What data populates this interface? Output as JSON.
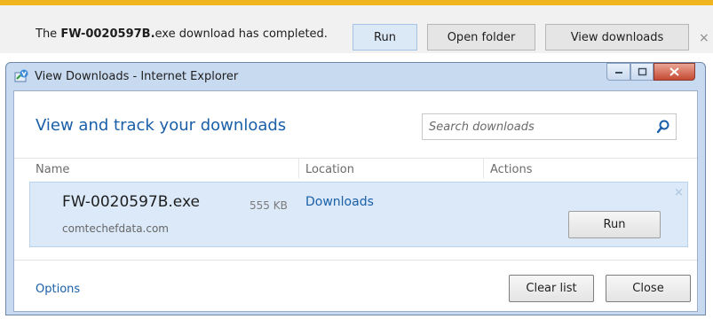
{
  "notification": {
    "text_prefix": "The ",
    "filename": "FW-0020597B.",
    "text_suffix": "exe download has completed.",
    "run_label": "Run",
    "open_folder_label": "Open folder",
    "view_downloads_label": "View downloads",
    "close_glyph": "×",
    "accent_color": "#f0b41e"
  },
  "window": {
    "title": "View Downloads - Internet Explorer",
    "heading": "View and track your downloads",
    "search_placeholder": "Search downloads",
    "columns": {
      "name": "Name",
      "location": "Location",
      "actions": "Actions"
    },
    "download": {
      "filename": "FW-0020597B.exe",
      "size": "555 KB",
      "domain": "comtechefdata.com",
      "location": "Downloads",
      "action_label": "Run",
      "dismiss_glyph": "×"
    },
    "footer": {
      "options_label": "Options",
      "clear_list_label": "Clear list",
      "close_label": "Close"
    },
    "icons": [
      "ie-downloads-icon",
      "search-icon",
      "minimize-icon",
      "maximize-icon",
      "close-icon"
    ]
  }
}
